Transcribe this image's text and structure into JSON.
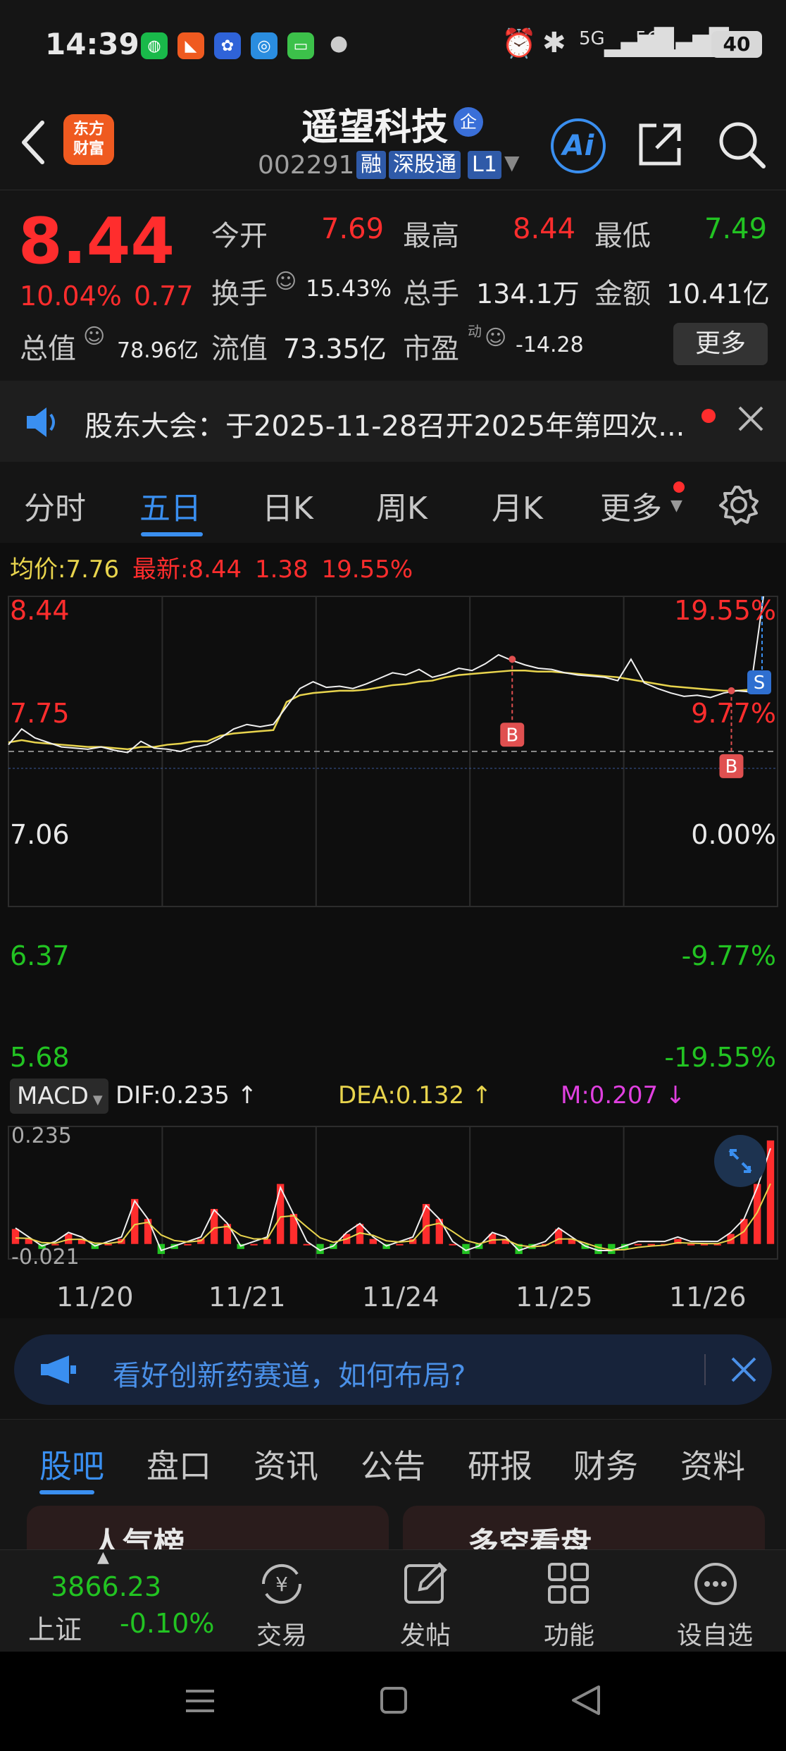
{
  "status_bar": {
    "time": "14:39",
    "signal1": "5G",
    "signal2": "5G",
    "battery": "40"
  },
  "header": {
    "logo_line1": "东方",
    "logo_line2": "财富",
    "stock_name": "遥望科技",
    "badge": "企",
    "stock_code": "002291",
    "tag_margin": "融",
    "tag_connect": "深股通",
    "tag_level": "L1",
    "ai_label": "Ai"
  },
  "quote": {
    "price": "8.44",
    "change_pct": "10.04%",
    "change": "0.77",
    "open_label": "今开",
    "open_value": "7.69",
    "high_label": "最高",
    "high_value": "8.44",
    "low_label": "最低",
    "low_value": "7.49",
    "turnover_label": "换手",
    "turnover_value": "15.43%",
    "volume_label": "总手",
    "volume_value": "134.1万",
    "amount_label": "金额",
    "amount_value": "10.41亿",
    "mcap_label": "总值",
    "mcap_value": "78.96亿",
    "float_label": "流值",
    "float_value": "73.35亿",
    "pe_label": "市盈",
    "pe_sup": "动",
    "pe_value": "-14.28",
    "more_label": "更多"
  },
  "notice": {
    "text": "股东大会：于2025-11-28召开2025年第四次..."
  },
  "chart_tabs": [
    "分时",
    "五日",
    "日K",
    "周K",
    "月K",
    "更多"
  ],
  "chart_info": {
    "avg_label": "均价:",
    "avg_value": "7.76",
    "latest_label": "最新:",
    "latest_value": "8.44",
    "latest_change": "1.38",
    "latest_pct": "19.55%"
  },
  "chart_data": {
    "type": "line",
    "title": "",
    "x_tick_labels": [
      "11/20",
      "11/21",
      "11/24",
      "11/25",
      "11/26"
    ],
    "y_left_ticks": [
      "8.44",
      "7.75",
      "7.06",
      "6.37",
      "5.68"
    ],
    "y_right_ticks": [
      "19.55%",
      "9.77%",
      "0.00%",
      "-9.77%",
      "-19.55%"
    ],
    "ylim": [
      5.68,
      8.44
    ],
    "prev_close": 7.06,
    "series": [
      {
        "values": [
          7.12,
          7.26,
          7.18,
          7.14,
          7.1,
          7.09,
          7.08,
          7.1,
          7.07,
          7.05,
          7.15,
          7.09,
          7.08,
          7.06,
          7.1,
          7.12,
          7.18,
          7.26,
          7.3,
          7.28,
          7.3,
          7.46,
          7.62,
          7.68,
          7.63,
          7.64,
          7.62,
          7.66,
          7.71,
          7.76,
          7.74,
          7.79,
          7.72,
          7.75,
          7.8,
          7.78,
          7.84,
          7.92,
          7.87,
          7.83,
          7.8,
          7.79,
          7.76,
          7.74,
          7.73,
          7.72,
          7.69,
          7.88,
          7.67,
          7.62,
          7.58,
          7.55,
          7.56,
          7.54,
          7.58,
          7.6,
          7.59,
          8.44
        ]
      },
      {
        "values": [
          7.14,
          7.16,
          7.14,
          7.13,
          7.12,
          7.11,
          7.1,
          7.1,
          7.09,
          7.08,
          7.1,
          7.1,
          7.12,
          7.13,
          7.15,
          7.15,
          7.2,
          7.22,
          7.23,
          7.24,
          7.25,
          7.5,
          7.56,
          7.58,
          7.59,
          7.6,
          7.6,
          7.61,
          7.63,
          7.65,
          7.66,
          7.68,
          7.69,
          7.72,
          7.74,
          7.75,
          7.76,
          7.77,
          7.78,
          7.78,
          7.77,
          7.77,
          7.76,
          7.75,
          7.74,
          7.73,
          7.72,
          7.7,
          7.68,
          7.66,
          7.64,
          7.63,
          7.62,
          7.61,
          7.6,
          7.6,
          7.61,
          7.63
        ]
      }
    ],
    "markers": [
      "B",
      "B",
      "S"
    ]
  },
  "macd": {
    "selector": "MACD",
    "dif": "DIF:0.235",
    "dea": "DEA:0.132",
    "m": "M:0.207",
    "top_label": "0.235",
    "bottom_label": "-0.021",
    "histogram": [
      0.03,
      0.01,
      -0.01,
      0.0,
      0.02,
      0.01,
      -0.01,
      0.0,
      0.01,
      0.09,
      0.05,
      -0.02,
      -0.01,
      0.0,
      0.01,
      0.07,
      0.04,
      -0.01,
      0.0,
      0.01,
      0.12,
      0.06,
      0.0,
      -0.02,
      -0.01,
      0.02,
      0.04,
      0.01,
      -0.01,
      0.0,
      0.01,
      0.08,
      0.05,
      0.0,
      -0.02,
      -0.01,
      0.02,
      0.01,
      -0.02,
      -0.01,
      0.0,
      0.03,
      0.01,
      -0.01,
      -0.02,
      -0.02,
      -0.01,
      0.0,
      0.0,
      0.0,
      0.01,
      0.0,
      0.0,
      0.0,
      0.02,
      0.05,
      0.12,
      0.207
    ]
  },
  "banner": {
    "text": "看好创新药赛道，如何布局?"
  },
  "info_tabs": [
    "股吧",
    "盘口",
    "资讯",
    "公告",
    "研报",
    "财务",
    "资料"
  ],
  "feed_peek": [
    "人气榜",
    "多空看盘"
  ],
  "bottom_nav": {
    "index_value": "3866.23",
    "index_name": "上证",
    "index_change": "-0.10%",
    "items": [
      "交易",
      "发帖",
      "功能",
      "设自选"
    ]
  },
  "colors": {
    "up": "#ff2d2d",
    "down": "#22c322",
    "accent": "#3a8ff0",
    "avg_line": "#e8d44d"
  }
}
